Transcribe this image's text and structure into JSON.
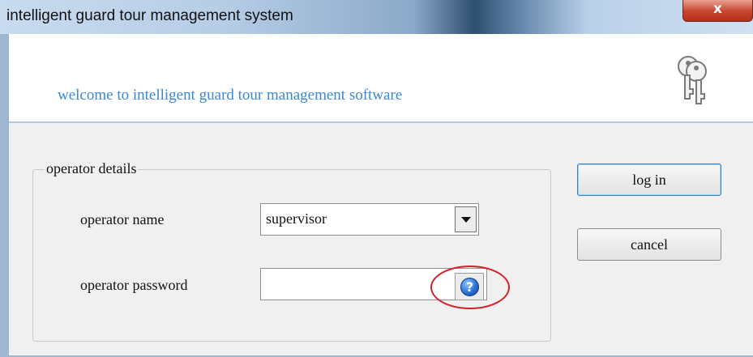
{
  "window": {
    "title": "intelligent guard tour management system",
    "close_label": "x"
  },
  "banner": {
    "welcome": "welcome to intelligent guard tour management software",
    "icon": "keys-icon"
  },
  "form": {
    "group_title": "operator details",
    "name_label": "operator name",
    "name_value": "supervisor",
    "password_label": "operator password",
    "password_value": "",
    "help_icon": "help-icon",
    "help_glyph": "?"
  },
  "buttons": {
    "login": "log in",
    "cancel": "cancel"
  },
  "colors": {
    "welcome_text": "#3b88d8",
    "highlight_ring": "#d51f2a",
    "close_button": "#c8442c"
  }
}
